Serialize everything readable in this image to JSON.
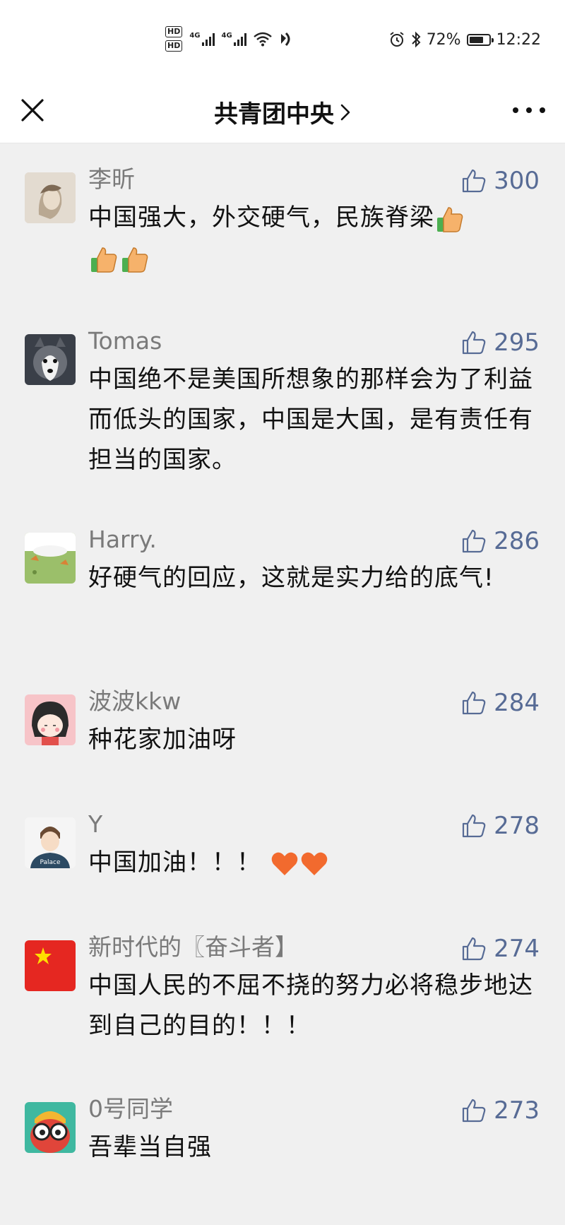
{
  "status": {
    "hd1": "HD",
    "hd2": "HD",
    "net1": "4G",
    "net2": "4G",
    "battery_percent": "72%",
    "battery_level": 0.72,
    "time": "12:22"
  },
  "nav": {
    "title": "共青团中央",
    "chevron": ">"
  },
  "comments": [
    {
      "name": "李昕",
      "likes": "300",
      "text": "中国强大，外交硬气，民族脊梁",
      "emoji_after": [
        "thumbs-up",
        "thumbs-up",
        "thumbs-up"
      ],
      "avatar": "sketch-portrait"
    },
    {
      "name": "Tomas",
      "likes": "295",
      "text": "中国绝不是美国所想象的那样会为了利益而低头的国家，中国是大国，是有责任有担当的国家。",
      "emoji_after": [],
      "avatar": "husky-dog"
    },
    {
      "name": "Harry.",
      "likes": "286",
      "text": "好硬气的回应，这就是实力给的底气!",
      "emoji_after": [],
      "avatar": "cartoon-landscape"
    },
    {
      "name": "波波kkw",
      "likes": "284",
      "text": "种花家加油呀",
      "emoji_after": [],
      "avatar": "cartoon-girl"
    },
    {
      "name": "Y",
      "likes": "278",
      "text": "中国加油！！！",
      "emoji_after": [
        "heart",
        "heart"
      ],
      "avatar": "cartoon-boy-palace"
    },
    {
      "name": "新时代的〖奋斗者】",
      "likes": "274",
      "text": "中国人民的不屈不挠的努力必将稳步地达到自己的目的！！！",
      "emoji_after": [],
      "avatar": "red-flag-star"
    },
    {
      "name": "0号同学",
      "likes": "273",
      "text": "吾辈当自强",
      "emoji_after": [],
      "avatar": "cartoon-glasses"
    }
  ]
}
